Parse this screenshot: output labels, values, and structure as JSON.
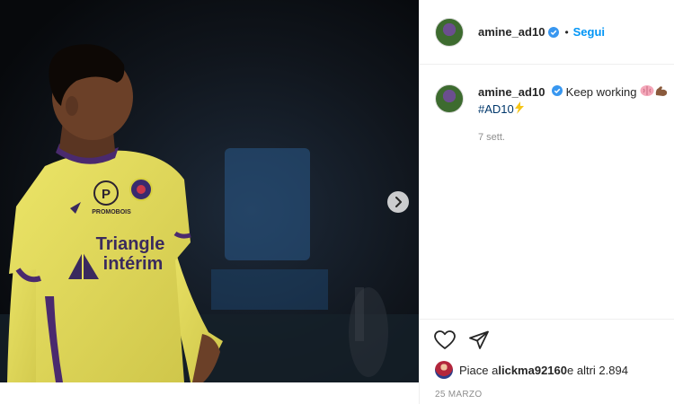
{
  "post": {
    "username": "amine_ad10",
    "follow_label": "Segui",
    "separator": "•",
    "caption_text": " Keep working ",
    "hashtag": "#AD10",
    "time_ago": "7 sett.",
    "likes_prefix": "Piace a ",
    "likes_user": "lickma92160",
    "likes_suffix": " e altri 2.894",
    "date": "25 MARZO"
  },
  "photo": {
    "jersey_sponsor_line1": "Triangle",
    "jersey_sponsor_line2": "intérim",
    "jersey_badge_text": "P",
    "jersey_badge_sub": "PROMOBOIS"
  },
  "colors": {
    "accent_blue": "#0095f6",
    "verified_blue": "#3897f0",
    "jersey_yellow": "#e8e05a",
    "jersey_purple": "#4a2a6e"
  },
  "icons": [
    "verified-badge-icon",
    "chevron-right-icon",
    "heart-icon",
    "share-icon",
    "brain-emoji-icon",
    "muscle-emoji-icon",
    "lightning-emoji-icon"
  ]
}
